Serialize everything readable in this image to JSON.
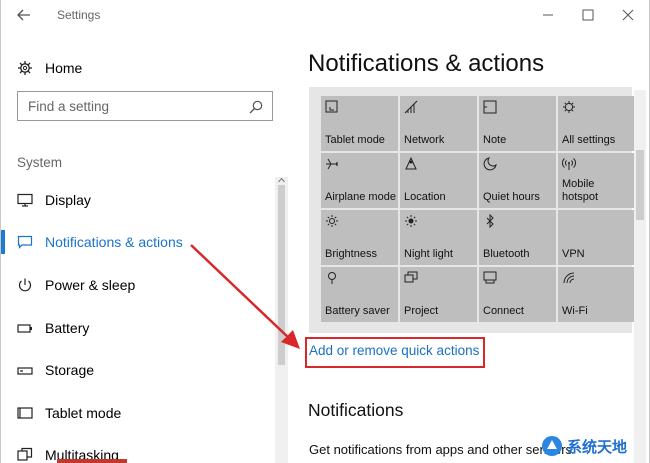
{
  "window": {
    "title": "Settings"
  },
  "left": {
    "home_label": "Home",
    "search_placeholder": "Find a setting",
    "section": "System",
    "items": [
      {
        "label": "Display",
        "icon": "monitor-icon"
      },
      {
        "label": "Notifications & actions",
        "icon": "notification-icon",
        "active": true
      },
      {
        "label": "Power & sleep",
        "icon": "power-icon"
      },
      {
        "label": "Battery",
        "icon": "battery-icon"
      },
      {
        "label": "Storage",
        "icon": "storage-icon"
      },
      {
        "label": "Tablet mode",
        "icon": "tablet-icon"
      },
      {
        "label": "Multitasking",
        "icon": "multitasking-icon"
      }
    ]
  },
  "right": {
    "title": "Notifications & actions",
    "tiles": [
      {
        "label": "Tablet mode",
        "icon": "tablet-mode-icon"
      },
      {
        "label": "Network",
        "icon": "network-icon"
      },
      {
        "label": "Note",
        "icon": "note-icon"
      },
      {
        "label": "All settings",
        "icon": "gear-icon"
      },
      {
        "label": "Airplane mode",
        "icon": "airplane-icon"
      },
      {
        "label": "Location",
        "icon": "location-icon"
      },
      {
        "label": "Quiet hours",
        "icon": "moon-icon"
      },
      {
        "label": "Mobile hotspot",
        "icon": "hotspot-icon"
      },
      {
        "label": "Brightness",
        "icon": "brightness-icon"
      },
      {
        "label": "Night light",
        "icon": "night-light-icon"
      },
      {
        "label": "Bluetooth",
        "icon": "bluetooth-icon"
      },
      {
        "label": "VPN",
        "icon": "vpn-icon"
      },
      {
        "label": "Battery saver",
        "icon": "battery-saver-icon"
      },
      {
        "label": "Project",
        "icon": "project-icon"
      },
      {
        "label": "Connect",
        "icon": "connect-icon"
      },
      {
        "label": "Wi-Fi",
        "icon": "wifi-icon"
      }
    ],
    "link": "Add or remove quick actions",
    "notifications_heading": "Notifications",
    "notifications_desc": "Get notifications from apps and other senders"
  },
  "watermark": {
    "text": "系统天地"
  },
  "colors": {
    "accent": "#1e7bd4",
    "annotation": "#d8282c",
    "tile": "#bebebe",
    "panel": "#e6e6e6"
  }
}
